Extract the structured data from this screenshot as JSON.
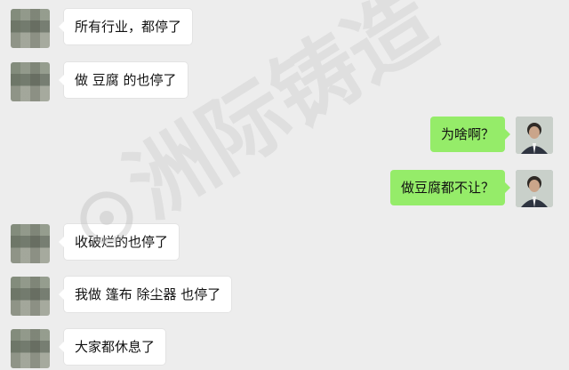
{
  "chat": {
    "messages": [
      {
        "side": "left",
        "text": "所有行业，都停了"
      },
      {
        "side": "left",
        "text": "做 豆腐 的也停了"
      },
      {
        "side": "right",
        "text": "为啥啊？"
      },
      {
        "side": "right",
        "text": "做豆腐都不让？"
      },
      {
        "side": "left",
        "text": "收破烂的也停了"
      },
      {
        "side": "left",
        "text": "我做 篷布 除尘器 也停了"
      },
      {
        "side": "left",
        "text": "大家都休息了"
      }
    ]
  },
  "watermark": {
    "text": "洲际铸造"
  },
  "colors": {
    "background": "#ededed",
    "incoming_bubble": "#ffffff",
    "outgoing_bubble": "#95ec69",
    "text": "#111111"
  }
}
